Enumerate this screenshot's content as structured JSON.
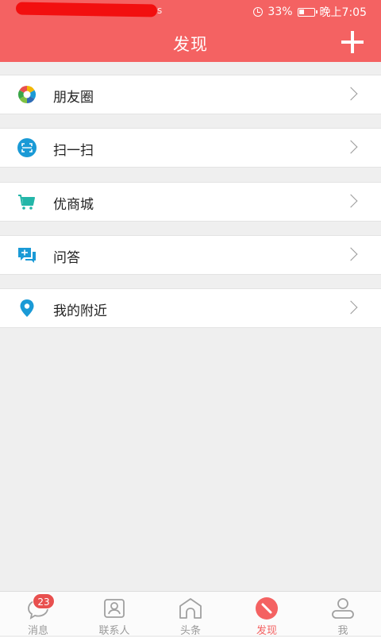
{
  "status_bar": {
    "carrier_visible": "s",
    "battery": "33%",
    "time": "晚上7:05"
  },
  "header": {
    "title": "发现",
    "add_icon": "plus-icon"
  },
  "menu": [
    {
      "label": "朋友圈",
      "icon": "moments-icon"
    },
    {
      "label": "扫一扫",
      "icon": "scan-icon"
    },
    {
      "label": "优商城",
      "icon": "cart-icon"
    },
    {
      "label": "问答",
      "icon": "qa-chat-icon"
    },
    {
      "label": "我的附近",
      "icon": "location-pin-icon"
    }
  ],
  "tabs": [
    {
      "label": "消息",
      "icon": "message-icon",
      "badge": "23"
    },
    {
      "label": "联系人",
      "icon": "contacts-icon"
    },
    {
      "label": "头条",
      "icon": "headlines-icon"
    },
    {
      "label": "发现",
      "icon": "discover-icon",
      "active": true
    },
    {
      "label": "我",
      "icon": "profile-icon"
    }
  ],
  "colors": {
    "accent": "#f46262",
    "background": "#efefef",
    "icon_blue": "#1a9ad6",
    "badge": "#e8504f"
  }
}
